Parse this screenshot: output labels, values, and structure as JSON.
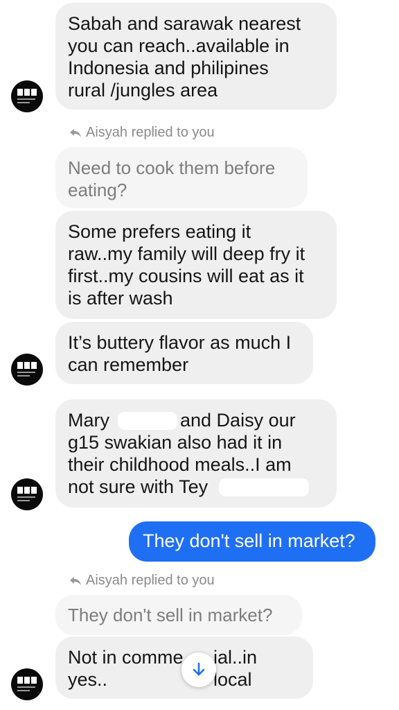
{
  "messages": {
    "m1": "Sabah and sarawak nearest\nyou can reach..available in\nIndonesia and philipines\nrural /jungles area",
    "reply1_label": "Aisyah replied to you",
    "reply1_quote": "Need to cook them before\neating?",
    "m2": "Some prefers eating it\nraw..my family will deep fry it\nfirst..my cousins will eat as it\nis after wash",
    "m3": "It’s buttery flavor as much I\ncan remember",
    "m4_line1a": "Mary",
    "m4_line1b": "and Daisy our",
    "m4_rest": "g15 swakian also had it in\ntheir childhood meals..I am",
    "m4_last": "not sure with Tey",
    "sent1": "They don't sell in market?",
    "reply2_label": "Aisyah replied to you",
    "reply2_quote": "They don't sell in market?",
    "m5_line1a": "Not in comme",
    "m5_line1b": "ial..in local",
    "m5_line2": "yes.."
  },
  "colors": {
    "sent_bubble": "#1f6ff5",
    "received_bubble": "#efefef"
  },
  "icons": {
    "reply": "reply-arrow-icon",
    "avatar": "contact-avatar",
    "scroll": "arrow-down-icon"
  }
}
